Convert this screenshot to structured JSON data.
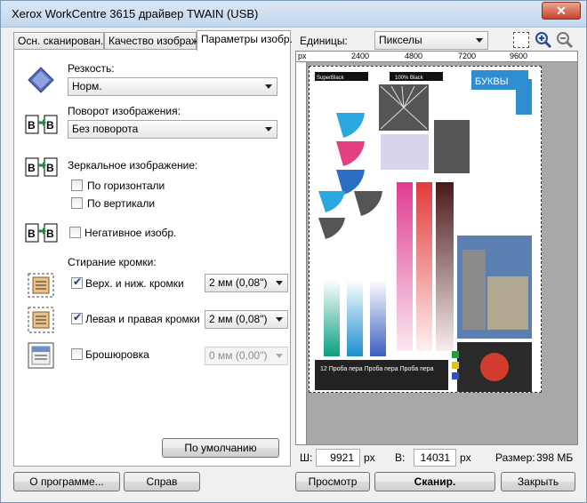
{
  "window": {
    "title": "Xerox WorkCentre 3615 драйвер TWAIN (USB)",
    "close_glyph": "✕"
  },
  "tabs": [
    {
      "label": "Осн. сканирован."
    },
    {
      "label": "Качество изображ."
    },
    {
      "label": "Параметры изобр."
    }
  ],
  "sharpness": {
    "label": "Резкость:",
    "value": "Норм."
  },
  "rotation": {
    "label": "Поворот изображения:",
    "value": "Без поворота"
  },
  "mirror": {
    "label": "Зеркальное изображение:",
    "horizontal": {
      "label": "По горизонтали",
      "checked": false
    },
    "vertical": {
      "label": "По вертикали",
      "checked": false
    }
  },
  "negative": {
    "label": "Негативное изобр.",
    "checked": false
  },
  "edge_erase": {
    "label": "Стирание кромки:",
    "top_bottom": {
      "label": "Верх. и ниж. кромки",
      "checked": true,
      "value": "2 мм (0,08\")"
    },
    "left_right": {
      "label": "Левая и правая кромки",
      "checked": true,
      "value": "2 мм (0,08\")"
    },
    "binding": {
      "label": "Брошюровка",
      "checked": false,
      "value": "0 мм (0,00\")"
    }
  },
  "defaults_button": "По умолчанию",
  "units": {
    "label": "Единицы:",
    "value": "Пикселы"
  },
  "ruler": {
    "unit": "px",
    "ticks": [
      "2400",
      "4800",
      "7200",
      "9600"
    ]
  },
  "preview_doc": {
    "header_left": "SuperBlack",
    "header_mid": "100% Black",
    "badge1": "БУКВЫ",
    "badge2": "БУКВЫ",
    "caption": "12 Проба пера Проба пера Проба пера"
  },
  "size": {
    "width_label": "Ш:",
    "width_value": "9921",
    "width_unit": "px",
    "height_label": "В:",
    "height_value": "14031",
    "height_unit": "px",
    "size_label": "Размер:",
    "size_value": "398 МБ"
  },
  "buttons": {
    "about": "О программе...",
    "help": "Справ",
    "preview": "Просмотр",
    "scan": "Сканир.",
    "close": "Закрыть"
  }
}
